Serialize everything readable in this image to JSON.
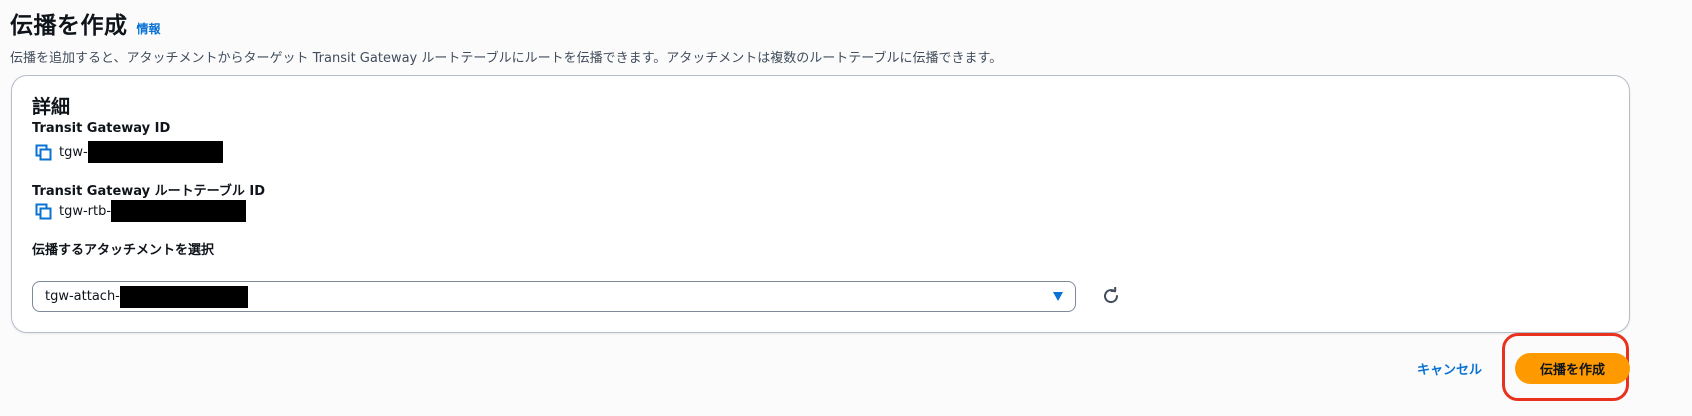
{
  "header": {
    "title": "伝播を作成",
    "info_link": "情報",
    "description": "伝播を追加すると、アタッチメントからターゲット Transit Gateway ルートテーブルにルートを伝播できます。アタッチメントは複数のルートテーブルに伝播できます。"
  },
  "details": {
    "heading": "詳細",
    "tgw_id_label": "Transit Gateway ID",
    "tgw_id_prefix": "tgw-",
    "route_table_label": "Transit Gateway ルートテーブル ID",
    "route_table_prefix": "tgw-rtb-",
    "attachment_label": "伝播するアタッチメントを選択",
    "attachment_value": "tgw-attach-"
  },
  "footer": {
    "cancel_label": "キャンセル",
    "create_label": "伝播を作成"
  },
  "colors": {
    "primary_button": "#ff9900",
    "link": "#0972d3",
    "highlight": "#e8321e"
  },
  "icons": [
    "copy-icon",
    "caret-down-icon",
    "refresh-icon"
  ]
}
